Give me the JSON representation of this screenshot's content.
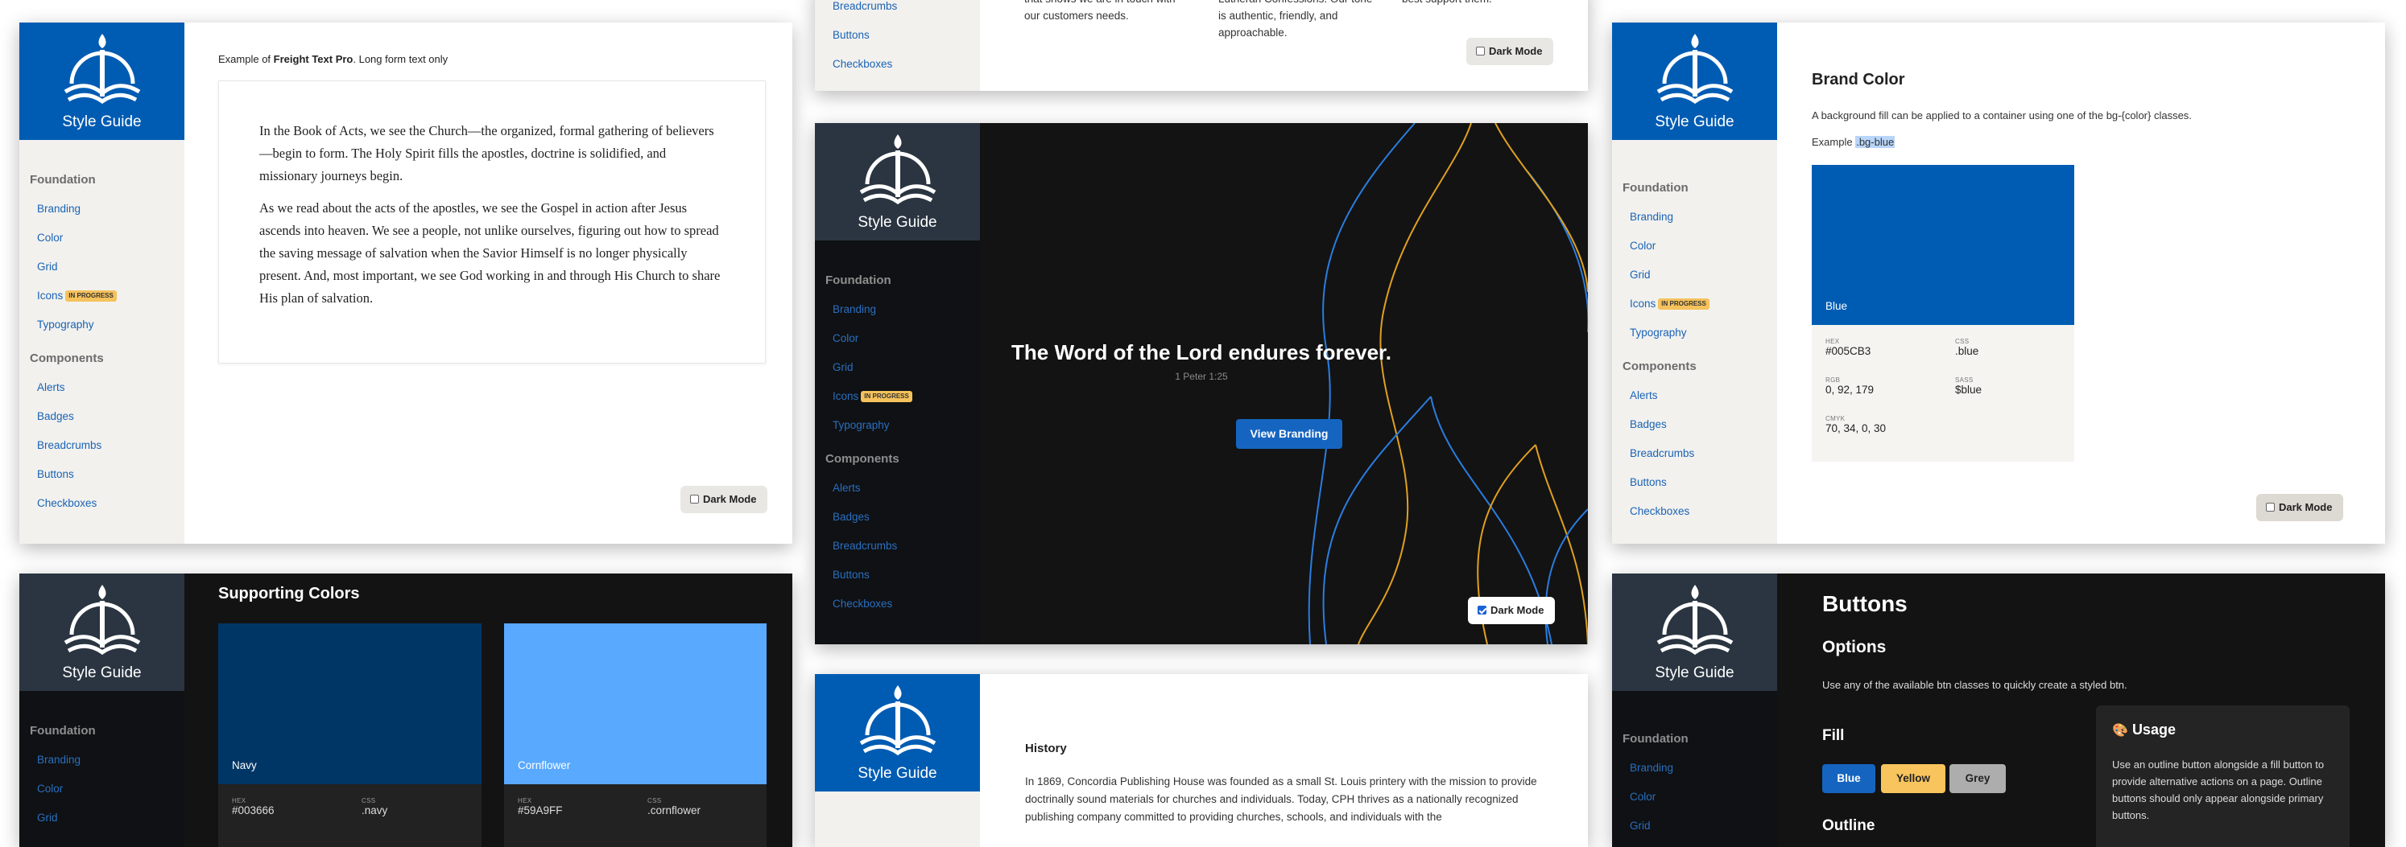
{
  "brand": {
    "logo_text": "Style Guide",
    "blue": "#005CB3",
    "navy": "#003666",
    "cornflower": "#59A9FF"
  },
  "nav": {
    "foundation": "Foundation",
    "components": "Components",
    "branding": "Branding",
    "color": "Color",
    "grid": "Grid",
    "icons": "Icons",
    "in_progress": "IN PROGRESS",
    "typography": "Typography",
    "alerts": "Alerts",
    "badges": "Badges",
    "breadcrumbs": "Breadcrumbs",
    "buttons": "Buttons",
    "checkboxes": "Checkboxes"
  },
  "dark_mode": "Dark Mode",
  "typography_panel": {
    "example_prefix": "Example of ",
    "font_name": "Freight Text Pro",
    "example_suffix": ". Long form text only",
    "p1": "In the Book of Acts, we see the Church—the organized, formal gathering of believers—begin to form. The Holy Spirit fills the apostles, doctrine is solidified, and missionary journeys begin.",
    "p2": "As we read about the acts of the apostles, we see the Gospel in action after Jesus ascends into heaven. We see a people, not unlike ourselves, figuring out how to spread the saving message of salvation when the Savior Himself is no longer physically present. And, most important, we see God working in and through His Church to share His plan of salvation."
  },
  "top_mid_panel": {
    "col1": "that shows we are in touch with our customers needs.",
    "col2": "Lutheran Confessions. Our tone is authentic, friendly, and approachable.",
    "col3": "best support them."
  },
  "hero_panel": {
    "title": "The Word of the Lord endures forever.",
    "ref": "1 Peter 1:25",
    "button": "View Branding"
  },
  "brand_color_panel": {
    "title": "Brand Color",
    "desc": "A background fill can be applied to a container using one of the bg-{color} classes.",
    "example_label": "Example",
    "example_class": ".bg-blue",
    "swatch_name": "Blue",
    "hex_label": "HEX",
    "hex": "#005CB3",
    "css_label": "CSS",
    "css": ".blue",
    "rgb_label": "RGB",
    "rgb": "0, 92, 179",
    "sass_label": "SASS",
    "sass": "$blue",
    "cmyk_label": "CMYK",
    "cmyk": "70, 34, 0, 30"
  },
  "supporting_panel": {
    "title": "Supporting Colors",
    "navy_name": "Navy",
    "navy_hex_label": "HEX",
    "navy_hex": "#003666",
    "navy_css_label": "CSS",
    "navy_css": ".navy",
    "corn_name": "Cornflower",
    "corn_hex_label": "HEX",
    "corn_hex": "#59A9FF",
    "corn_css_label": "CSS",
    "corn_css": ".cornflower"
  },
  "history_panel": {
    "title": "History",
    "p": "In 1869, Concordia Publishing House was founded as a small St. Louis printery with the mission to provide doctrinally sound materials for churches and individuals. Today, CPH thrives as a nationally recognized publishing company committed to providing churches, schools, and individuals with the"
  },
  "buttons_panel": {
    "title": "Buttons",
    "options": "Options",
    "desc": "Use any of the available btn classes to quickly create a styled btn.",
    "fill": "Fill",
    "blue": "Blue",
    "yellow": "Yellow",
    "grey": "Grey",
    "outline": "Outline",
    "usage_title": "Usage",
    "usage_text": "Use an outline button alongside a fill button to provide alternative actions on a page. Outline buttons should only appear alongside primary buttons."
  }
}
